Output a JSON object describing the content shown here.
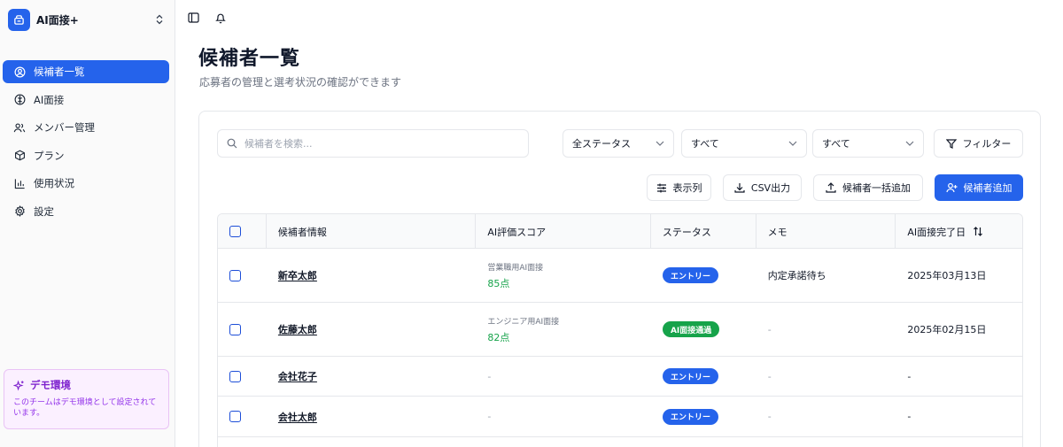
{
  "app": {
    "name": "AI面接+"
  },
  "sidebar": {
    "items": [
      {
        "label": "候補者一覧",
        "icon": "user-circle-icon",
        "active": true
      },
      {
        "label": "AI面接",
        "icon": "brain-icon",
        "active": false
      },
      {
        "label": "メンバー管理",
        "icon": "users-icon",
        "active": false
      },
      {
        "label": "プラン",
        "icon": "box-icon",
        "active": false
      },
      {
        "label": "使用状況",
        "icon": "bar-chart-icon",
        "active": false
      },
      {
        "label": "設定",
        "icon": "gear-icon",
        "active": false
      }
    ],
    "demo": {
      "title": "デモ環境",
      "text": "このチームはデモ環境として設定されています。"
    }
  },
  "header": {
    "title": "候補者一覧",
    "subtitle": "応募者の管理と選考状況の確認ができます"
  },
  "filters": {
    "search_placeholder": "候補者を検索...",
    "status_select": "全ステータス",
    "select_2": "すべて",
    "select_3": "すべて",
    "filter_button": "フィルター"
  },
  "actions": {
    "columns": "表示列",
    "csv": "CSV出力",
    "bulk_add": "候補者一括追加",
    "add": "候補者追加"
  },
  "table": {
    "headers": [
      "候補者情報",
      "AI評価スコア",
      "ステータス",
      "メモ",
      "AI面接完了日"
    ],
    "rows": [
      {
        "name": "新卒太郎",
        "score_label": "営業職用AI面接",
        "score": "85点",
        "status": "エントリー",
        "memo": "内定承諾待ち",
        "date": "2025年03月13日"
      },
      {
        "name": "佐藤太郎",
        "score_label": "エンジニア用AI面接",
        "score": "82点",
        "status": "AI面接通過",
        "memo": "-",
        "date": "2025年02月15日"
      },
      {
        "name": "会社花子",
        "score_label": "",
        "score": "-",
        "status": "エントリー",
        "memo": "-",
        "date": "-"
      },
      {
        "name": "会社太郎",
        "score_label": "",
        "score": "-",
        "status": "エントリー",
        "memo": "-",
        "date": "-"
      }
    ]
  },
  "colors": {
    "primary": "#2563eb",
    "badge_entry": "#2563eb",
    "badge_passed": "#16a34a",
    "score_green": "#16a34a",
    "demo_purple": "#7e22ce"
  }
}
